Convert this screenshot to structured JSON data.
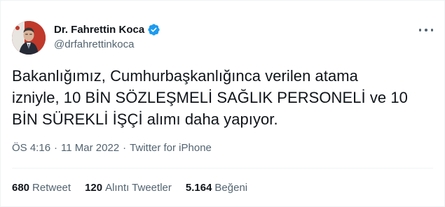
{
  "author": {
    "display_name": "Dr. Fahrettin Koca",
    "handle": "@drfahrettinkoca",
    "verified": true,
    "avatar_icon": "profile-photo"
  },
  "tweet": {
    "line1": "Bakanlığımız, Cumhurbaşkanlığınca verilen atama",
    "line2": "izniyle, 10 BİN SÖZLEŞMELİ SAĞLIK PERSONELİ ve 10",
    "line3": "BİN SÜREKLİ İŞÇİ alımı daha yapıyor."
  },
  "meta": {
    "time": "ÖS 4:16",
    "date": "11 Mar 2022",
    "source": "Twitter for iPhone",
    "separator": "·"
  },
  "stats": {
    "retweets": {
      "count": "680",
      "label": "Retweet"
    },
    "quotes": {
      "count": "120",
      "label": "Alıntı Tweetler"
    },
    "likes": {
      "count": "5.164",
      "label": "Beğeni"
    }
  },
  "colors": {
    "text": "#0f1419",
    "secondary": "#536471",
    "verified_blue": "#1d9bf0",
    "divider": "#eff3f4"
  }
}
